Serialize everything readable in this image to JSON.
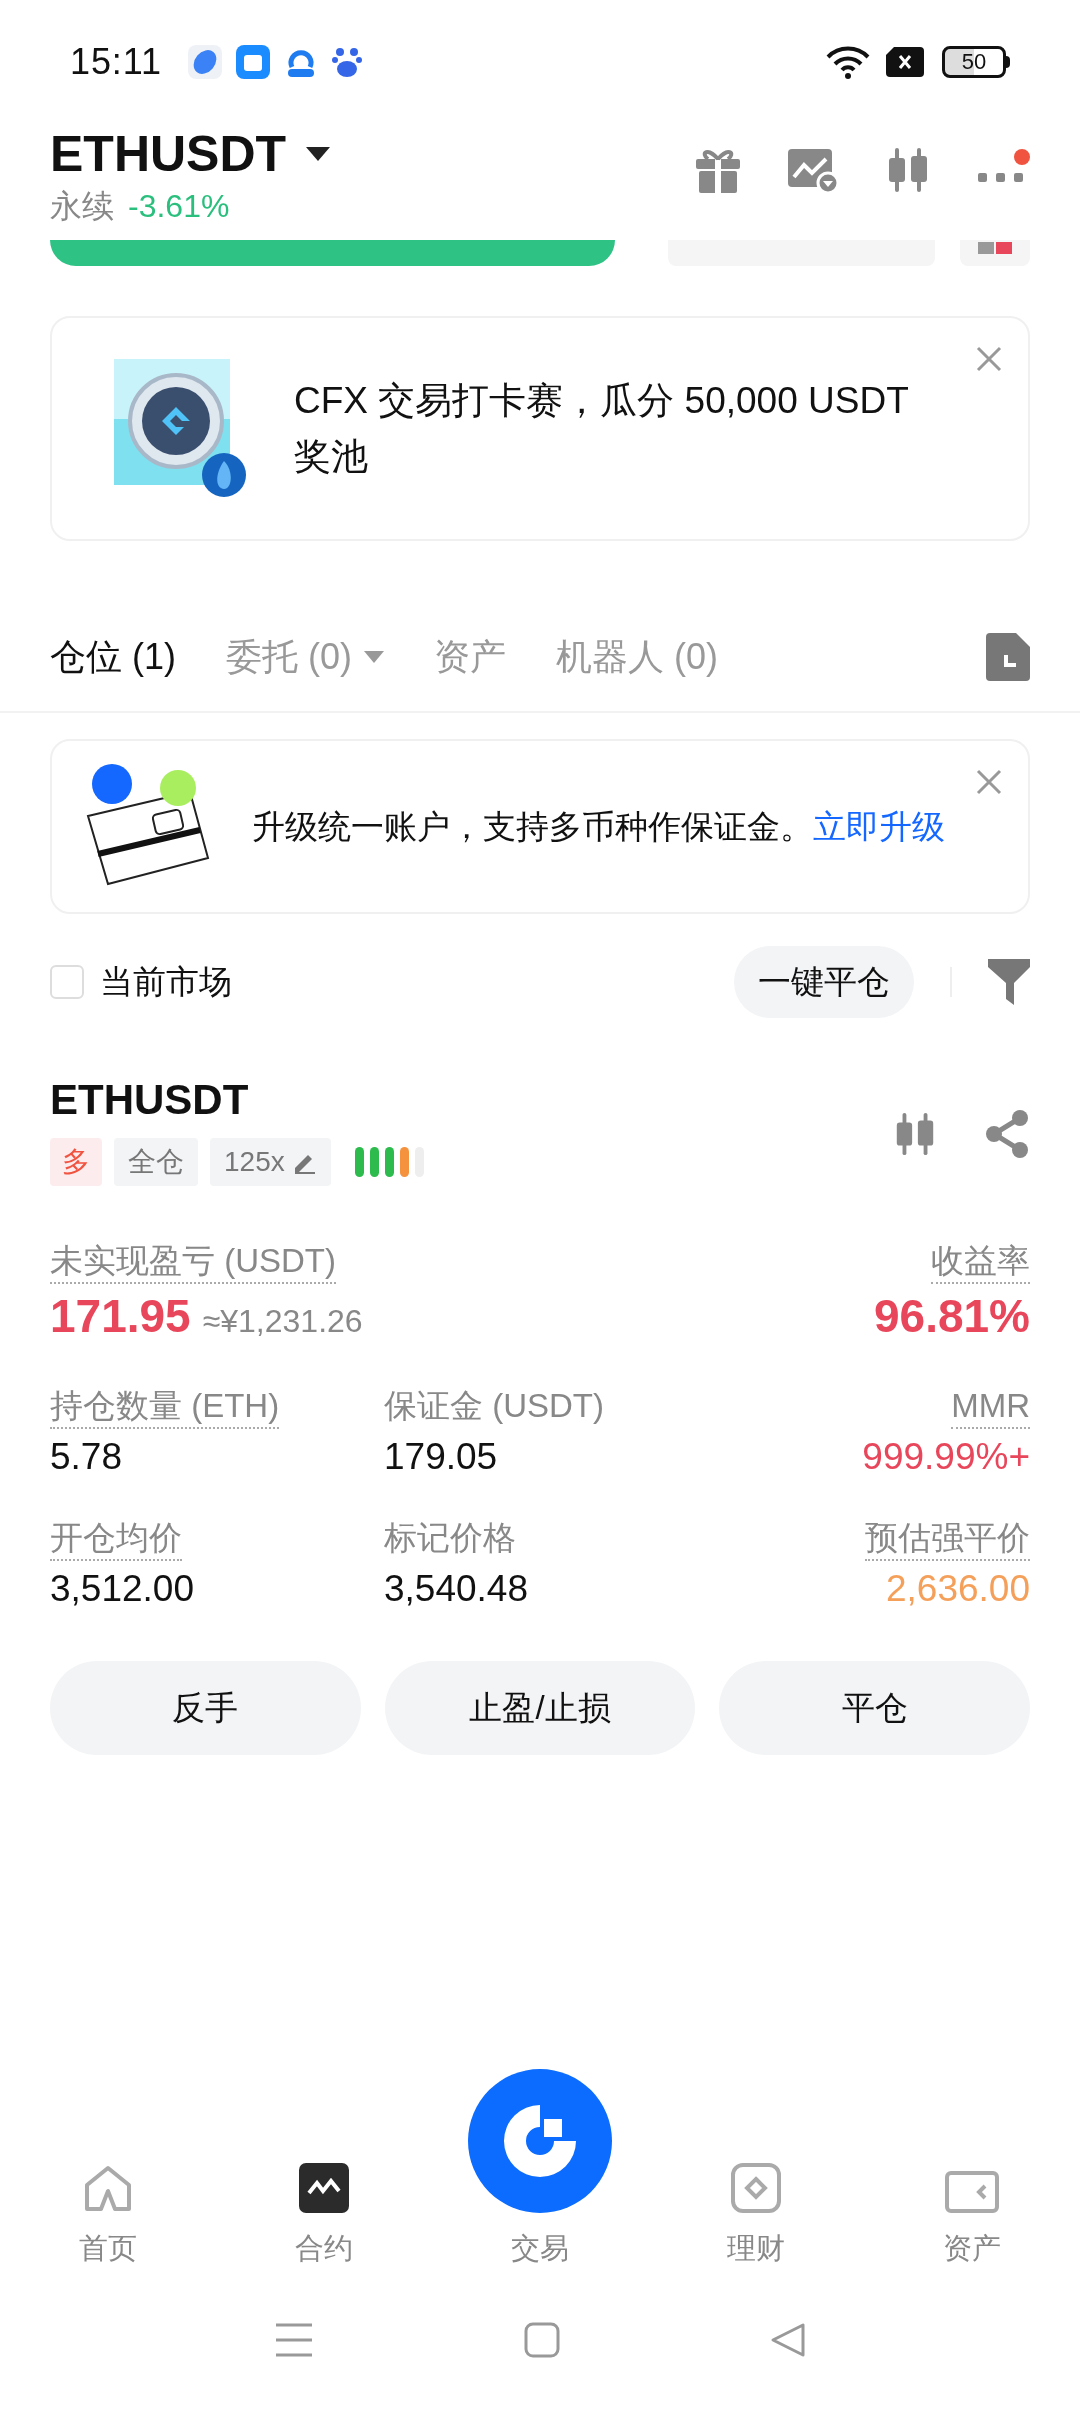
{
  "status_bar": {
    "time": "15:11",
    "battery": "50"
  },
  "header": {
    "symbol": "ETHUSDT",
    "type": "永续",
    "change": "-3.61%",
    "has_notification": true
  },
  "promo_banner": {
    "text": "CFX 交易打卡赛，瓜分 50,000 USDT 奖池"
  },
  "tabs": [
    {
      "label": "仓位 (1)",
      "selected": true,
      "dropdown": false
    },
    {
      "label": "委托 (0)",
      "selected": false,
      "dropdown": true
    },
    {
      "label": "资产",
      "selected": false,
      "dropdown": false
    },
    {
      "label": "机器人 (0)",
      "selected": false,
      "dropdown": false
    }
  ],
  "upgrade_banner": {
    "text": "升级统一账户，支持多币种作保证金。",
    "link": "立即升级"
  },
  "filter_bar": {
    "checkbox_label": "当前市场",
    "checked": false,
    "close_all_button": "一键平仓"
  },
  "position": {
    "symbol": "ETHUSDT",
    "side": "多",
    "margin_mode": "全仓",
    "leverage": "125x",
    "risk_bars": [
      {
        "color": "#2dbb4e"
      },
      {
        "color": "#2dbb4e"
      },
      {
        "color": "#2dbb4e"
      },
      {
        "color": "#f5923e"
      },
      {
        "color": "#eeeeee"
      }
    ],
    "pnl": {
      "label": "未实现盈亏 (USDT)",
      "value": "171.95",
      "converted": "≈¥1,231.26"
    },
    "roe": {
      "label": "收益率",
      "value": "96.81%"
    },
    "stats": [
      {
        "label": "持仓数量 (ETH)",
        "value": "5.78",
        "color": "#111111",
        "dotted": true
      },
      {
        "label": "保证金 (USDT)",
        "value": "179.05",
        "color": "#111111",
        "dotted": false
      },
      {
        "label": "MMR",
        "value": "999.99%+",
        "color": "#e8475b",
        "dotted": true
      },
      {
        "label": "开仓均价",
        "value": "3,512.00",
        "color": "#111111",
        "dotted": true
      },
      {
        "label": "标记价格",
        "value": "3,540.48",
        "color": "#111111",
        "dotted": false
      },
      {
        "label": "预估强平价",
        "value": "2,636.00",
        "color": "#f5a05a",
        "dotted": true
      }
    ],
    "buttons": [
      "反手",
      "止盈/止损",
      "平仓"
    ]
  },
  "bottom_nav": [
    {
      "label": "首页",
      "kind": "home",
      "selected": false
    },
    {
      "label": "合约",
      "kind": "futures",
      "selected": true
    },
    {
      "label": "交易",
      "kind": "trade",
      "selected": false
    },
    {
      "label": "理财",
      "kind": "earn",
      "selected": false
    },
    {
      "label": "资产",
      "kind": "assets",
      "selected": false
    }
  ]
}
